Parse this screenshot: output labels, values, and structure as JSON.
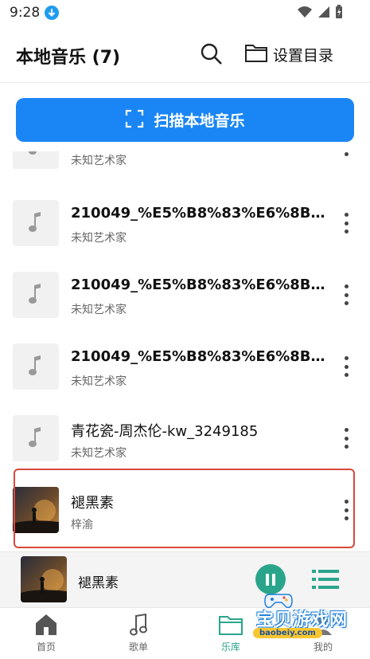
{
  "status_bar": {
    "time": "9:28"
  },
  "header": {
    "title": "本地音乐 (7)",
    "set_dir_label": "设置目录"
  },
  "scan_button": {
    "label": "扫描本地音乐"
  },
  "songs": [
    {
      "title": "",
      "artist": "未知艺术家"
    },
    {
      "title": "210049_%E5%B8%83%E6%8B%89...",
      "artist": "未知艺术家"
    },
    {
      "title": "210049_%E5%B8%83%E6%8B%89...",
      "artist": "未知艺术家"
    },
    {
      "title": "210049_%E5%B8%83%E6%8B%89...",
      "artist": "未知艺术家"
    },
    {
      "title": "青花瓷-周杰伦-kw_3249185",
      "artist": "未知艺术家"
    },
    {
      "title": "褪黑素",
      "artist": "梓渝"
    }
  ],
  "mini_player": {
    "title": "褪黑素"
  },
  "tabs": [
    {
      "label": "首页"
    },
    {
      "label": "歌单"
    },
    {
      "label": "乐库"
    },
    {
      "label": "我的"
    }
  ],
  "watermark": {
    "text": "宝贝游戏网",
    "url": "baobeiy.com"
  },
  "colors": {
    "accent": "#1a86f5",
    "player_accent": "#2aa58b",
    "highlight": "#d8483e"
  }
}
